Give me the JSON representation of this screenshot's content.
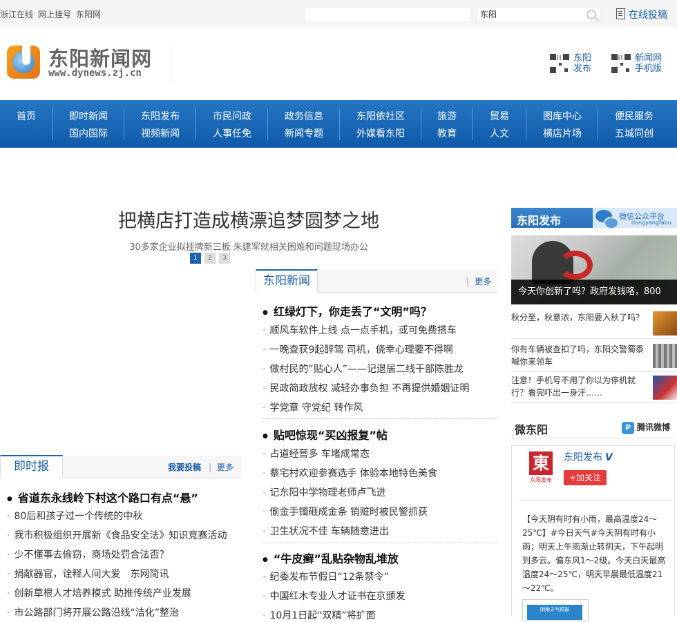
{
  "topbar": {
    "links": [
      "浙江在线",
      "网上挂号",
      "东阳网"
    ],
    "search_value": "东阳",
    "contribute": "在线投稿"
  },
  "header": {
    "logo_cn": "东阳新闻网",
    "logo_en": "www.dynews.zj.cn",
    "qr1": [
      "东阳",
      "发布"
    ],
    "qr2": [
      "新闻网",
      "手机版"
    ]
  },
  "nav": [
    [
      "首页",
      ""
    ],
    [
      "即时新闻",
      "国内国际"
    ],
    [
      "东阳发布",
      "视频新闻"
    ],
    [
      "市民问政",
      "人事任免"
    ],
    [
      "政务信息",
      "新闻专题"
    ],
    [
      "东阳依社区",
      "外媒看东阳"
    ],
    [
      "旅游",
      "教育"
    ],
    [
      "贸易",
      "人文"
    ],
    [
      "图库中心",
      "横店片场"
    ],
    [
      "便民服务",
      "五城同创"
    ]
  ],
  "slider": {
    "headline": "把横店打造成横漂追梦圆梦之地",
    "subline": "30多家企业拟挂牌新三板 朱建军就相关困难和问题现场办公",
    "pages": [
      "1",
      "2",
      "3"
    ]
  },
  "dongyang_news": {
    "tab": "东阳新闻",
    "more": "更多",
    "groups": [
      {
        "headline": "红绿灯下，你走丢了“文明”吗？",
        "items": [
          "顺风车软件上线 点一点手机，或可免费搭车",
          "一晚查获9起醉驾 司机，侥幸心理要不得啊",
          "做村民的“贴心人”——记退居二线干部陈胜龙",
          "民政简政放权 减轻办事负担 不再提供婚姻证明",
          "学党章 守党纪 转作风"
        ]
      },
      {
        "headline": "贴吧惊现“买凶报复”帖",
        "items": [
          "占道经营多 车堵成常态",
          "蔡宅村欢迎参赛选手 体验本地特色美食",
          "记东阳中学物理老师卢飞进",
          "偷金手镯砸成金条 销赃时被民警抓获",
          "卫生状况不佳 车辆随意进出"
        ]
      },
      {
        "headline": "“牛皮癣”乱贴杂物乱堆放",
        "items": [
          "纪委发布节假日“12条禁令”",
          "中国红木专业人才证书在京颁发",
          "10月1日起“双精”将扩面"
        ]
      }
    ]
  },
  "instant_news": {
    "tab": "即时报",
    "submit": "我要投稿",
    "more": "更多",
    "headline": "省道东永线岭下村这个路口有点“悬”",
    "items": [
      "80后和孩子过一个传统的中秋",
      "我市积极组织开展新《食品安全法》知识竞赛活动",
      "少不懂事去偷窃，商场处罚合法否？",
      "捐献器官，诠释人间大爱　东网简讯",
      "创新草根人才培养模式 助推传统产业发展",
      "市公路部门将开展公路沿线“洁化”整治"
    ]
  },
  "right": {
    "bar_title": "东阳发布",
    "wechat_platform": "微信公众平台",
    "wechat_id": "dongyangfabu",
    "hero_caption": "今天你创新了吗？政府发钱咯，800",
    "news": [
      "秋分至，秋意浓，东阳要入秋了吗？",
      "你有车辆被查扣了吗，东阳交警蜀黍喊你来领车",
      "注意！手机号不用了你以为停机就行？看完吓出一身汗……"
    ],
    "weibo_title": "微东阳",
    "tencent_weibo": "腾讯微博",
    "account_name": "东阳发布",
    "account_logo_char": "東",
    "account_logo_label": "东阳发布",
    "verified": "V",
    "follow": "+加关注",
    "post": "【今天阴有时有小雨，最高温度24～25℃】#今日天气#今天阴有时有小雨；明天上午雨渐止转阴天，下午起明到多云。偏东风1～2级。今天白天最高温度24～25℃，明天早晨最低温度21～22℃。",
    "post_image_text": "阴雨天气预报"
  }
}
